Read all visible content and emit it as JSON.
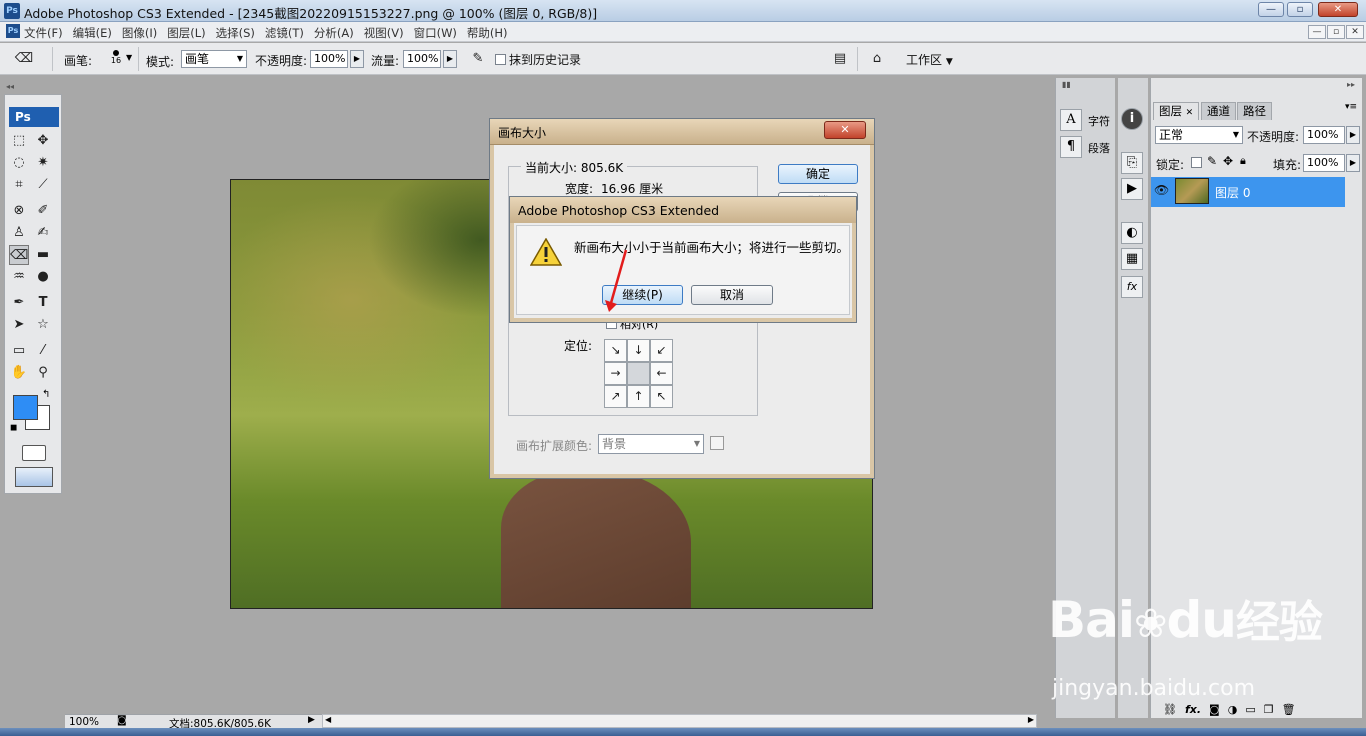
{
  "window": {
    "title": "Adobe Photoshop CS3 Extended - [2345截图20220915153227.png @ 100% (图层 0, RGB/8)]",
    "app_icon": "Ps",
    "minimize": "—",
    "maximize": "▫",
    "close": "✕"
  },
  "menu": [
    "文件(F)",
    "编辑(E)",
    "图像(I)",
    "图层(L)",
    "选择(S)",
    "滤镜(T)",
    "分析(A)",
    "视图(V)",
    "窗口(W)",
    "帮助(H)"
  ],
  "doc_controls": {
    "minimize": "—",
    "restore": "▫",
    "close": "✕"
  },
  "options": {
    "brush_label": "画笔:",
    "brush_size": "16",
    "mode_label": "模式:",
    "mode_value": "画笔",
    "opacity_label": "不透明度:",
    "opacity_value": "100%",
    "flow_label": "流量:",
    "flow_value": "100%",
    "erase_history": "抹到历史记录",
    "workspace": "工作区"
  },
  "toolbox": {
    "logo": "Ps"
  },
  "canvas_dialog": {
    "title": "画布大小",
    "close": "✕",
    "current_size_label": "当前大小: 805.6K",
    "width_label": "宽度:",
    "width_value": "16.96 厘米",
    "ok": "确定",
    "cancel_partial": "取消",
    "relative_label": "相对(R)",
    "anchor_label": "定位:",
    "anchors": [
      "↘",
      "↓",
      "↙",
      "→",
      "",
      "←",
      "↗",
      "↑",
      "↖"
    ],
    "ext_color_label": "画布扩展颜色:",
    "ext_color_value": "背景"
  },
  "alert": {
    "title": "Adobe Photoshop CS3 Extended",
    "message": "新画布大小小于当前画布大小；将进行一些剪切。",
    "continue": "继续(P)",
    "cancel": "取消"
  },
  "char_panel": {
    "char": "字符",
    "para": "段落"
  },
  "layers_panel": {
    "tabs": [
      "图层",
      "通道",
      "路径"
    ],
    "blend_mode": "正常",
    "opacity_label": "不透明度:",
    "opacity_value": "100%",
    "lock_label": "锁定:",
    "fill_label": "填充:",
    "fill_value": "100%",
    "layer_name": "图层 0",
    "bottom_icons": [
      "link-icon",
      "fx-icon",
      "mask-icon",
      "adjustment-icon",
      "folder-icon",
      "new-layer-icon",
      "trash-icon"
    ],
    "fx_text": "fx."
  },
  "status": {
    "zoom": "100%",
    "doc_info": "文档:805.6K/805.6K"
  },
  "watermark": {
    "logo": "Bai",
    "logo2": "du",
    "cn": "经验",
    "url": "jingyan.baidu.com"
  },
  "colors": {
    "foreground": "#2e8df5",
    "background": "#ffffff",
    "selected_layer": "#3d95ee"
  }
}
